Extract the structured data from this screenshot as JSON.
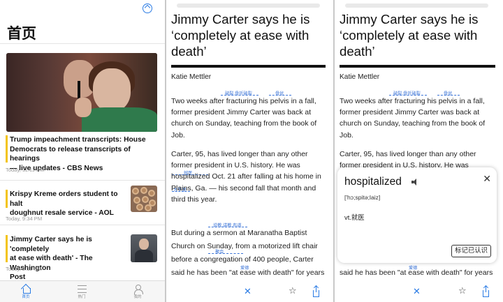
{
  "feed": {
    "title": "首页",
    "items": [
      {
        "headline_lines": [
          "Trump impeachment transcripts: House",
          "Democrats to release transcripts of hearings",
          "— live updates - CBS News"
        ],
        "time": "Today, 11:11 PM"
      },
      {
        "headline_lines": [
          "Krispy Kreme orders student to halt",
          "doughnut resale service - AOL"
        ],
        "time": "Today, 9:34 PM"
      },
      {
        "headline_lines": [
          "Jimmy Carter says he is 'completely",
          "at ease with death' - The Washington",
          "Post"
        ],
        "time": "Today, 9:11 PM"
      }
    ],
    "tabs": [
      {
        "label": "首页"
      },
      {
        "label": "热门"
      },
      {
        "label": "我的"
      }
    ]
  },
  "article": {
    "title_lines": [
      "Jimmy Carter says he is",
      "‘completely at ease with",
      "death’"
    ],
    "author": "Katie Mettler",
    "paragraphs": [
      [
        "Two weeks after  fracturing  his pelvis in a fall,",
        "former president Jimmy Carter was back at",
        "church on Sunday, teaching from the book of",
        "Job."
      ],
      [
        "Carter, 95, has lived longer than any other",
        "former president in U.S. history. He was",
        "hospitalized Oct. 21 after falling at his home in",
        "Plains, Ga. — his second fall that month and",
        "third this year."
      ],
      [
        "But during a   sermon   at Maranatha Baptist",
        "Church on Sunday, from a motorized lift chair",
        "before a congregation of 400 people, Carter",
        "said he has been \"at ease with death\" for years"
      ]
    ],
    "gloss": {
      "fracturing": "破裂,骨折破裂",
      "pelvis": "骨盆",
      "hospitalized": "就医",
      "plains": "大平原",
      "sermon": "说教,讲教,布道",
      "congregation": "聚会",
      "years": "爱德"
    },
    "popup_lines_p3": [
      "Carter, 95, has lived longer than any other",
      "former president in U.S. history. He was"
    ]
  },
  "popup": {
    "word": "hospitalized",
    "phonetic": "['hɔ;spitə;laiz]",
    "definition": "vt.就医",
    "known_button": "标记已认识"
  },
  "colors": {
    "accent": "#2a7be4",
    "highlight": "#f3c417",
    "gloss": "#3a73d6"
  }
}
